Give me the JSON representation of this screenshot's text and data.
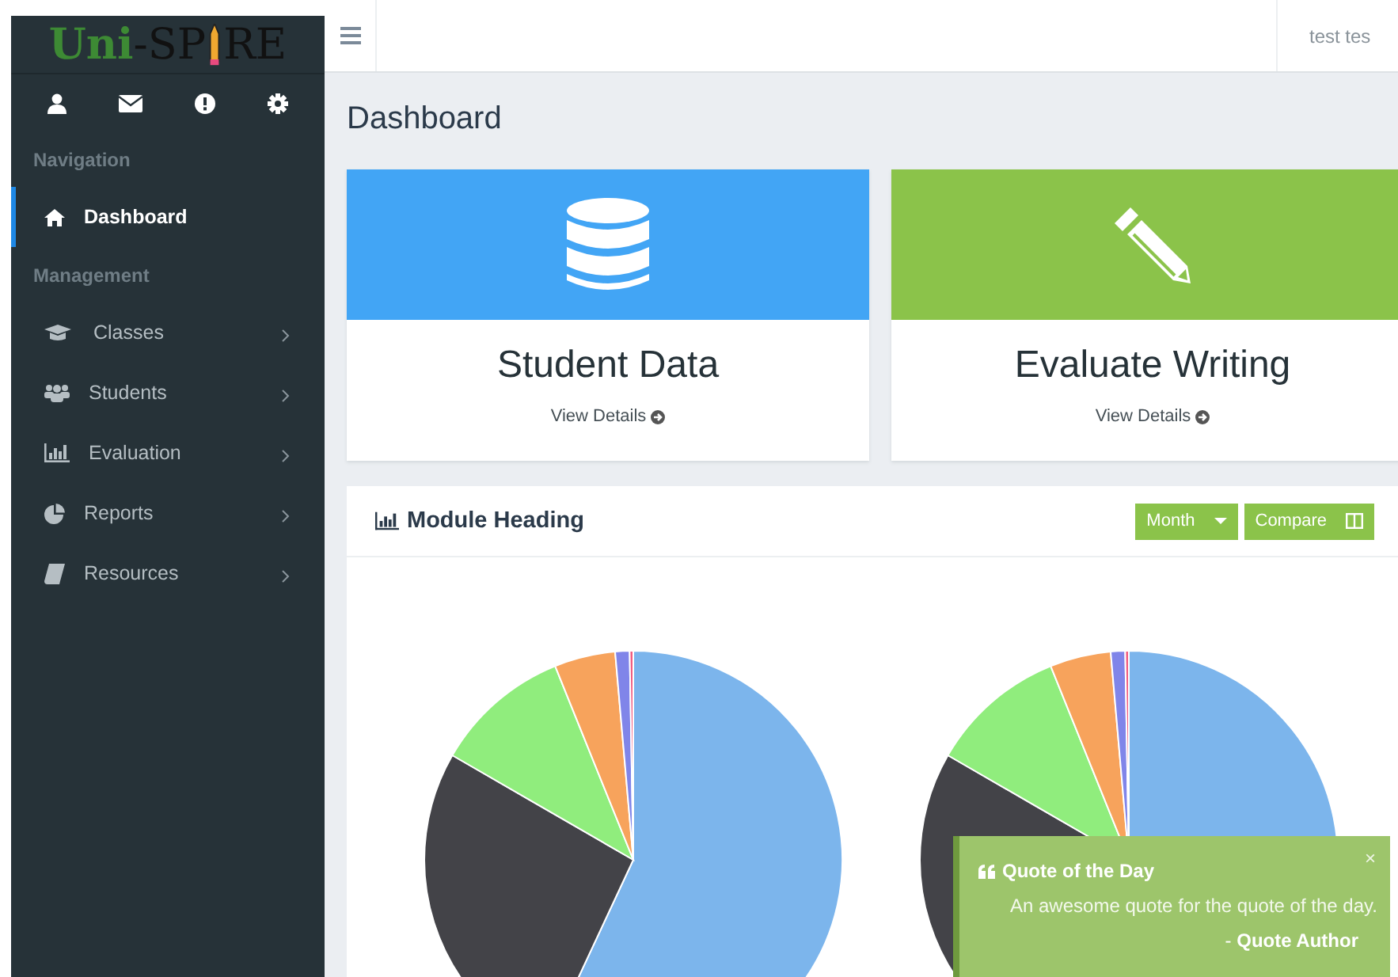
{
  "logo": {
    "part1": "Uni",
    "part2": "-SP",
    "part3": "RE"
  },
  "sidebar": {
    "sections": [
      {
        "title": "Navigation",
        "items": [
          {
            "label": "Dashboard",
            "selected": true,
            "submenu": false
          }
        ]
      },
      {
        "title": "Management",
        "items": [
          {
            "label": "Classes",
            "selected": false,
            "submenu": true
          },
          {
            "label": "Students",
            "selected": false,
            "submenu": true
          },
          {
            "label": "Evaluation",
            "selected": false,
            "submenu": true
          },
          {
            "label": "Reports",
            "selected": false,
            "submenu": true
          },
          {
            "label": "Resources",
            "selected": false,
            "submenu": true
          }
        ]
      }
    ]
  },
  "topbar": {
    "user": "test tes"
  },
  "page_title": "Dashboard",
  "cards": [
    {
      "title": "Student Data",
      "link": "View Details",
      "color": "#42a5f5"
    },
    {
      "title": "Evaluate Writing",
      "link": "View Details",
      "color": "#8bc34a"
    }
  ],
  "panel": {
    "title": "Module Heading",
    "buttons": [
      "Month",
      "Compare"
    ]
  },
  "toast": {
    "title": "Quote of the Day",
    "quote": "An awesome quote for the quote of the day.",
    "dash": "-",
    "author": "Quote Author",
    "close": "×"
  }
}
